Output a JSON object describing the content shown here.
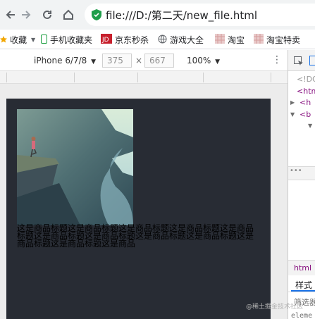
{
  "nav": {
    "back_icon": "arrow-left-icon",
    "forward_icon": "arrow-right-icon",
    "reload_icon": "reload-icon",
    "home_icon": "home-icon",
    "url": "file:///D:/第二天/new_file.html"
  },
  "bookmarks": [
    {
      "label": "收藏",
      "icon": "star-icon"
    },
    {
      "label": "手机收藏夹",
      "icon": "phone-icon"
    },
    {
      "label": "京东秒杀",
      "icon": "jd-icon"
    },
    {
      "label": "游戏大全",
      "icon": "globe-icon"
    },
    {
      "label": "淘宝",
      "icon": "taobao-icon"
    },
    {
      "label": "淘宝特卖",
      "icon": "taobao-icon"
    }
  ],
  "device_toolbar": {
    "device": "iPhone 6/7/8",
    "width": "375",
    "times": "×",
    "height": "667",
    "zoom": "100%"
  },
  "page": {
    "product_text": "这是商品标题这是商品标题这是商品标题这是商品标题这是商品标题这是商品标题这是商品标题这是商品标题这是商品标题这是商品标题这是商品标题这是商品"
  },
  "devtools": {
    "code_lines": [
      "<!DO",
      "<htm",
      "<h",
      "<b"
    ],
    "tab_html": "html",
    "tab_style": "样式",
    "filter": "筛选器",
    "element": "eleme"
  },
  "watermark": "@稀土掘金技术社区"
}
